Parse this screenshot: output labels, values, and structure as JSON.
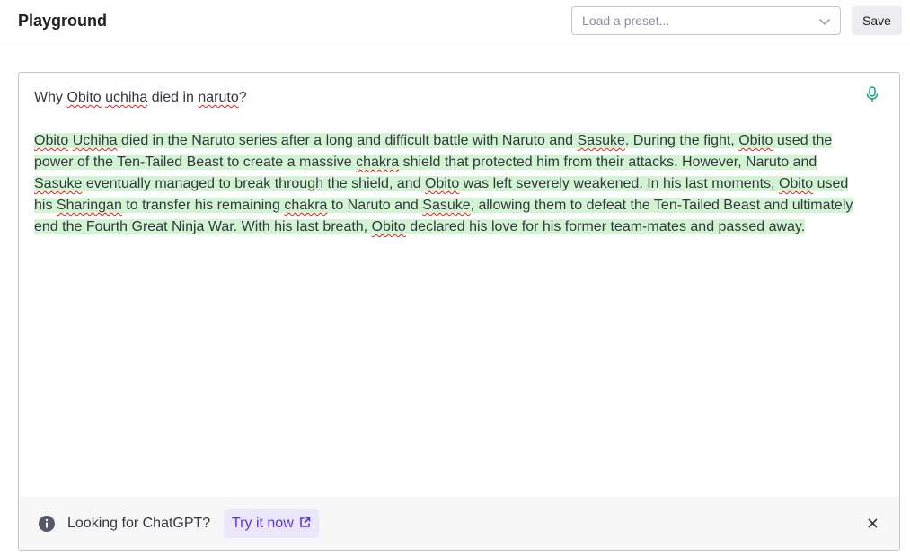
{
  "header": {
    "title": "Playground",
    "preset_placeholder": "Load a preset...",
    "save_label": "Save"
  },
  "editor": {
    "prompt": {
      "w1": "Why ",
      "w2": "Obito",
      "w3": " ",
      "w4": "uchiha",
      "w5": " died in ",
      "w6": "naruto",
      "w7": "?"
    },
    "completion": [
      "",
      "Obito",
      " ",
      "Uchiha",
      " died in the Naruto series after a long and difficult battle with Naruto and ",
      "Sasuke",
      ". During the fight, ",
      "Obito",
      " used the power of the Ten-Tailed Beast to create a massive ",
      "chakra",
      " shield that protected him from their attacks. However, Naruto and ",
      "Sasuke",
      " eventually managed to break through the shield, and ",
      "Obito",
      " was left severely weakened. In his last moments, ",
      "Obito",
      " used his ",
      "Sharingan",
      " to transfer his remaining ",
      "chakra",
      " to Naruto and ",
      "Sasuke",
      ", allowing them to defeat the Ten-Tailed Beast and ultimately end the Fourth Great Ninja War. With his last breath, ",
      "Obito",
      " declared his love for his former team-mates and passed away."
    ],
    "mic_icon": "microphone-icon",
    "highlight_color": "#d2f4d3",
    "spellcheck_color": "#e02020"
  },
  "notice": {
    "text": "Looking for ChatGPT?",
    "link_label": "Try it now",
    "info_icon": "info-icon",
    "external_icon": "external-link-icon",
    "close_icon": "close-icon",
    "accent": "#5436da"
  }
}
